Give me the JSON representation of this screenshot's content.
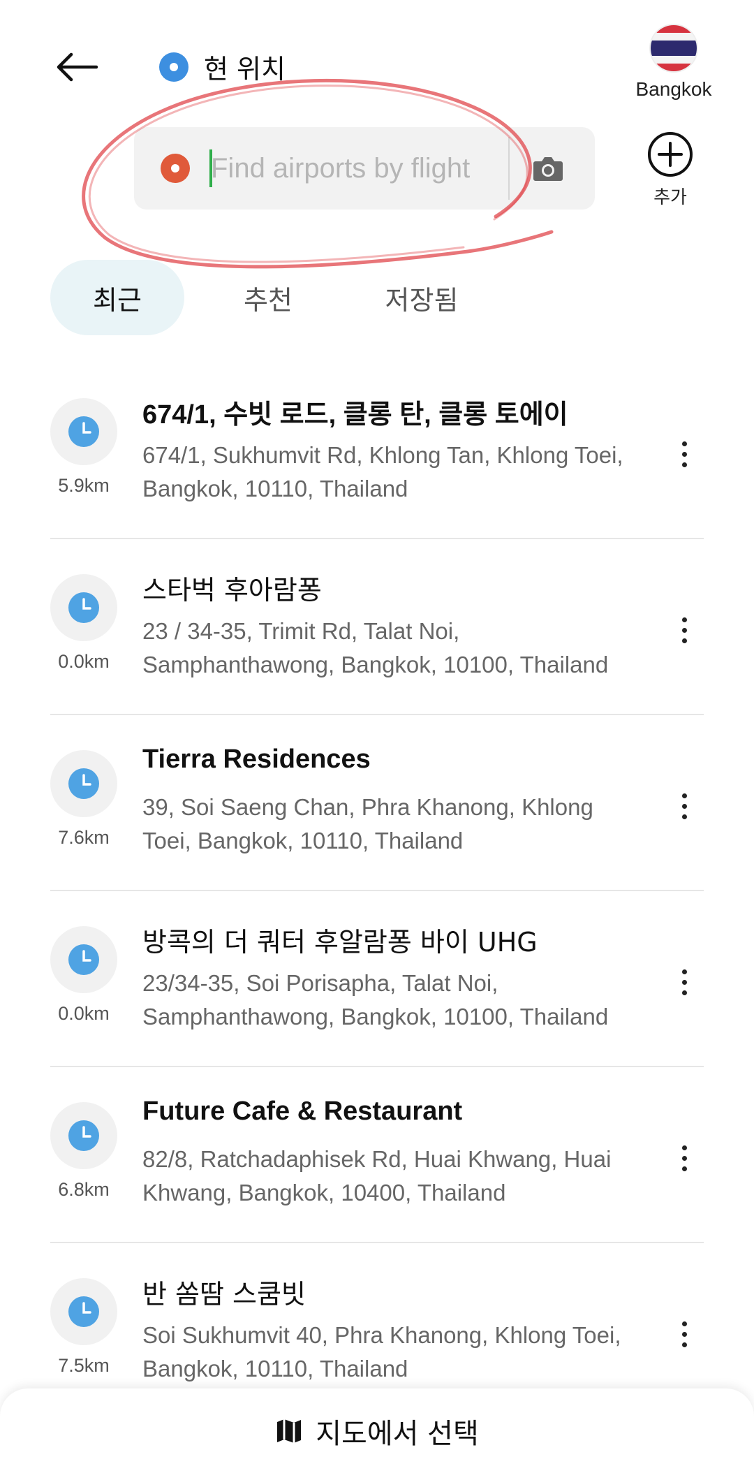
{
  "header": {
    "back_icon": "arrow-left-icon",
    "origin_label": "현 위치",
    "search": {
      "placeholder": "Find airports by flight",
      "camera_icon": "camera-icon"
    },
    "city": {
      "label": "Bangkok",
      "flag": "thailand-flag-icon"
    },
    "add": {
      "label": "추가",
      "icon": "plus-circle-icon"
    }
  },
  "tabs": [
    {
      "label": "최근",
      "active": true
    },
    {
      "label": "추천",
      "active": false
    },
    {
      "label": "저장됨",
      "active": false
    }
  ],
  "places": [
    {
      "title": "674/1, 수빗 로드, 클롱 탄, 클롱 토에이",
      "address": "674/1, Sukhumvit Rd, Khlong Tan, Khlong Toei, Bangkok, 10110, Thailand",
      "distance": "5.9km"
    },
    {
      "title": "스타벅 후아람퐁",
      "address": "23 / 34-35, Trimit Rd, Talat Noi, Samphanthawong, Bangkok, 10100, Thailand",
      "distance": "0.0km"
    },
    {
      "title": "Tierra Residences",
      "address": "39, Soi Saeng Chan, Phra Khanong, Khlong Toei, Bangkok, 10110, Thailand",
      "distance": "7.6km"
    },
    {
      "title": "방콕의 더 쿼터 후알람퐁 바이 UHG",
      "address": "23/34-35, Soi Porisapha, Talat Noi, Samphanthawong, Bangkok, 10100, Thailand",
      "distance": "0.0km"
    },
    {
      "title": "Future Cafe & Restaurant",
      "address": "82/8, Ratchadaphisek Rd, Huai Khwang, Huai Khwang, Bangkok, 10400, Thailand",
      "distance": "6.8km"
    },
    {
      "title": "반 쏨땀 스쿰빗",
      "address": "Soi Sukhumvit 40, Phra Khanong, Khlong Toei, Bangkok, 10110, Thailand",
      "distance": "7.5km"
    }
  ],
  "bottom": {
    "label": "지도에서 선택",
    "icon": "map-icon"
  },
  "colors": {
    "origin_dot": "#3d8fe0",
    "destination_dot": "#e05a3a",
    "clock_icon": "#4fa3e3",
    "active_tab_bg": "#e9f4f7",
    "annotation": "#e0474c"
  }
}
